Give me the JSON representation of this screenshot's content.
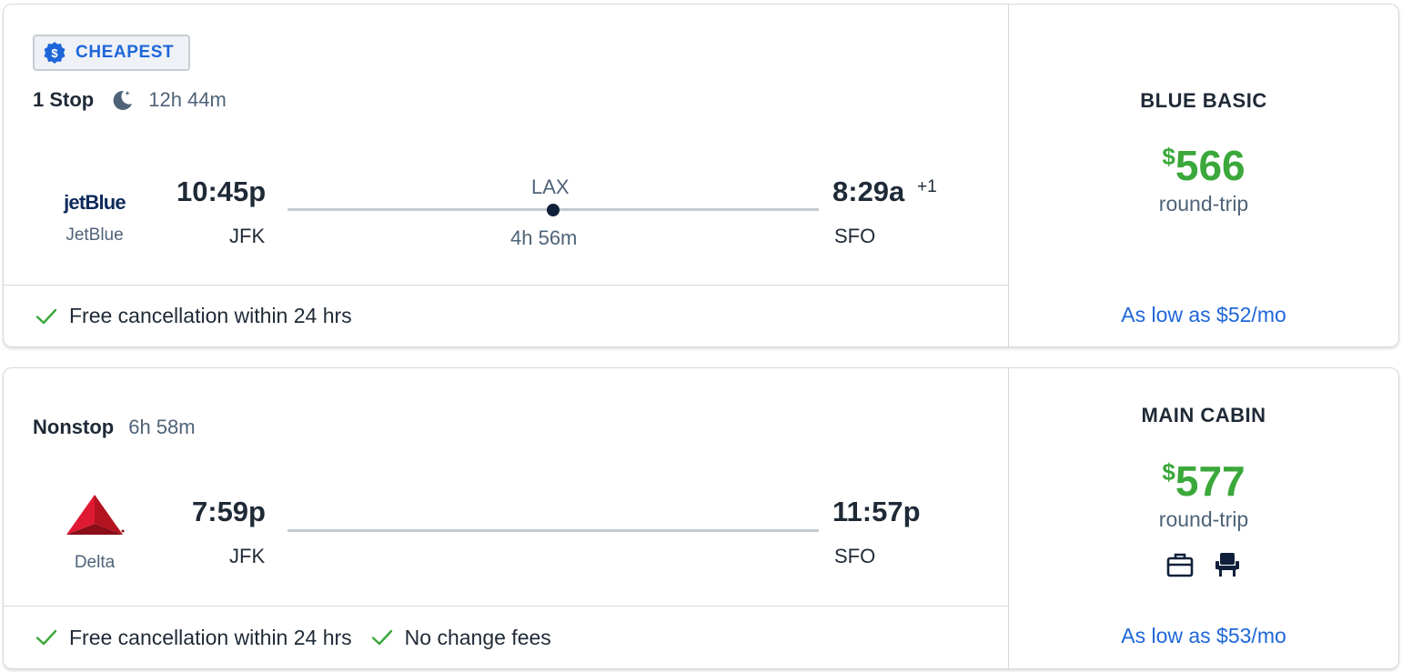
{
  "flights": [
    {
      "badge": "CHEAPEST",
      "stops": "1 Stop",
      "duration": "12h 44m",
      "overnight": true,
      "airline": {
        "name": "JetBlue",
        "logo_text": "jetBlue"
      },
      "depart": {
        "time": "10:45p",
        "airport": "JFK"
      },
      "arrive": {
        "time": "8:29a",
        "airport": "SFO",
        "day_offset": "+1"
      },
      "layover": {
        "airport": "LAX",
        "duration": "4h 56m"
      },
      "features": [
        "Free cancellation within 24 hrs"
      ],
      "fare": {
        "class": "BLUE BASIC",
        "currency": "$",
        "price": "566",
        "trip_type": "round-trip",
        "financing": "As low as $52/mo"
      }
    },
    {
      "stops": "Nonstop",
      "duration": "6h 58m",
      "airline": {
        "name": "Delta"
      },
      "depart": {
        "time": "7:59p",
        "airport": "JFK"
      },
      "arrive": {
        "time": "11:57p",
        "airport": "SFO"
      },
      "features": [
        "Free cancellation within 24 hrs",
        "No change fees"
      ],
      "fare": {
        "class": "MAIN CABIN",
        "currency": "$",
        "price": "577",
        "trip_type": "round-trip",
        "financing": "As low as $53/mo",
        "amenity_icons": [
          "carry-on-bag-icon",
          "seat-icon"
        ]
      }
    }
  ],
  "colors": {
    "price": "#3aa83a",
    "link": "#1e66d9",
    "check": "#3aa83a",
    "badge_text": "#1e66d9"
  }
}
